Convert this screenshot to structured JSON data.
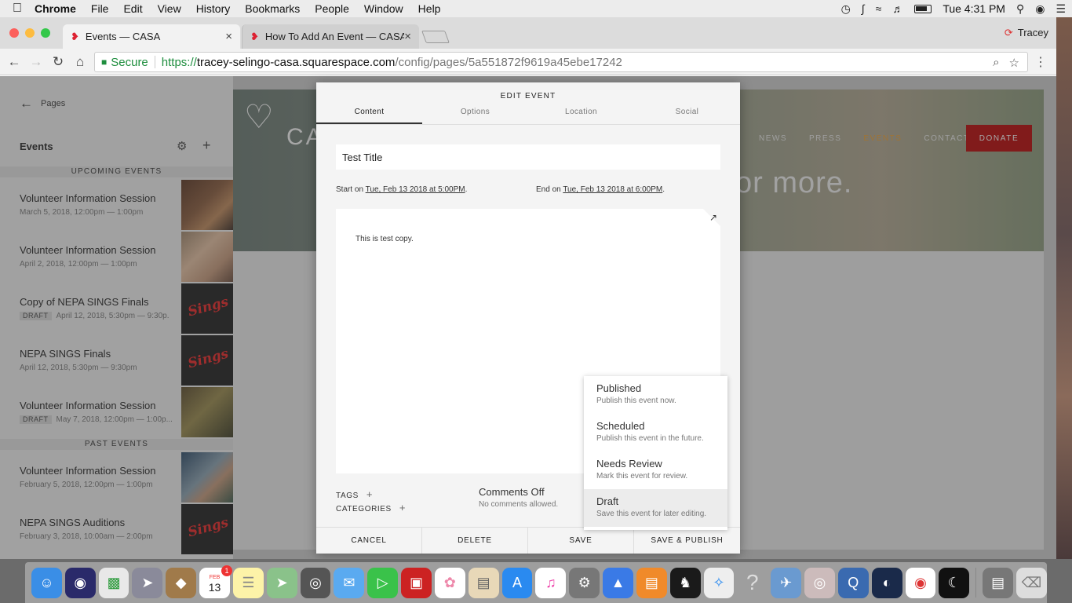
{
  "menubar": {
    "app": "Chrome",
    "items": [
      "File",
      "Edit",
      "View",
      "History",
      "Bookmarks",
      "People",
      "Window",
      "Help"
    ],
    "clock": "Tue 4:31 PM"
  },
  "browser": {
    "tabs": [
      {
        "title": "Events — CASA"
      },
      {
        "title": "How To Add An Event — CASA"
      }
    ],
    "profile": "Tracey",
    "secure_label": "Secure",
    "url_scheme": "https://",
    "url_host": "tracey-selingo-casa.squarespace.com",
    "url_path": "/config/pages/5a551872f9619a45ebe17242"
  },
  "sidebar": {
    "back_label": "Pages",
    "title": "Events",
    "upcoming_header": "UPCOMING EVENTS",
    "past_header": "PAST EVENTS",
    "draft_badge": "DRAFT",
    "upcoming": [
      {
        "name": "Volunteer Information Session",
        "date": "March 5, 2018, 12:00pm — 1:00pm"
      },
      {
        "name": "Volunteer Information Session",
        "date": "April 2, 2018, 12:00pm — 1:00pm"
      },
      {
        "name": "Copy of NEPA SINGS Finals",
        "date": "April 12, 2018, 5:30pm — 9:30p."
      },
      {
        "name": "NEPA SINGS Finals",
        "date": "April 12, 2018, 5:30pm — 9:30pm"
      },
      {
        "name": "Volunteer Information Session",
        "date": "May 7, 2018, 12:00pm — 1:00p..."
      }
    ],
    "past": [
      {
        "name": "Volunteer Information Session",
        "date": "February 5, 2018, 12:00pm — 1:00pm"
      },
      {
        "name": "NEPA SINGS Auditions",
        "date": "February 3, 2018, 10:00am — 2:00pm"
      }
    ]
  },
  "site": {
    "logo_text": "CASA",
    "nav": [
      "NEWS",
      "PRESS",
      "EVENTS",
      "CONTACT"
    ],
    "donate": "DONATE",
    "hero_text": "or more.",
    "thumb_text": "Sings"
  },
  "modal": {
    "title": "EDIT EVENT",
    "tabs": [
      "Content",
      "Options",
      "Location",
      "Social"
    ],
    "event_title": "Test Title",
    "start_label": "Start on",
    "start_value": "Tue, Feb 13 2018 at 5:00PM",
    "end_label": "End on",
    "end_value": "Tue, Feb 13 2018 at 6:00PM",
    "body_copy": "This is test copy.",
    "tags_label": "TAGS",
    "categories_label": "CATEGORIES",
    "comments_title": "Comments Off",
    "comments_sub": "No comments allowed.",
    "buttons": {
      "cancel": "CANCEL",
      "delete": "DELETE",
      "save": "SAVE",
      "save_publish": "SAVE & PUBLISH"
    }
  },
  "status_menu": [
    {
      "name": "Published",
      "desc": "Publish this event now."
    },
    {
      "name": "Scheduled",
      "desc": "Publish this event in the future."
    },
    {
      "name": "Needs Review",
      "desc": "Mark this event for review."
    },
    {
      "name": "Draft",
      "desc": "Save this event for later editing."
    }
  ],
  "dock": {
    "calendar_month": "FEB",
    "calendar_day": "13",
    "calendar_badge": "1"
  }
}
